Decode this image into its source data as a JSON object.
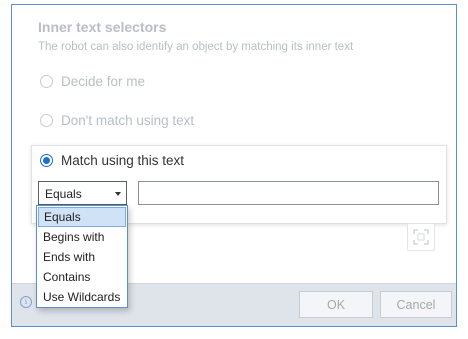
{
  "section": {
    "title": "Inner text selectors",
    "subtitle": "The robot can also identify an object by matching its inner text"
  },
  "options": [
    {
      "label": "Decide for me",
      "checked": false
    },
    {
      "label": "Don't match using text",
      "checked": false
    },
    {
      "label": "Match using this text",
      "checked": true
    }
  ],
  "match": {
    "operator": "Equals",
    "text_value": ""
  },
  "dropdown": {
    "items": [
      "Equals",
      "Begins with",
      "Ends with",
      "Contains",
      "Use Wildcards"
    ],
    "selected": "Equals"
  },
  "footer": {
    "info_icon": "info-icon",
    "ok_label": "OK",
    "cancel_label": "Cancel"
  },
  "colors": {
    "accent": "#1c6ed1",
    "border": "#5a8fd0",
    "footer_bg": "#dfe3ea"
  }
}
